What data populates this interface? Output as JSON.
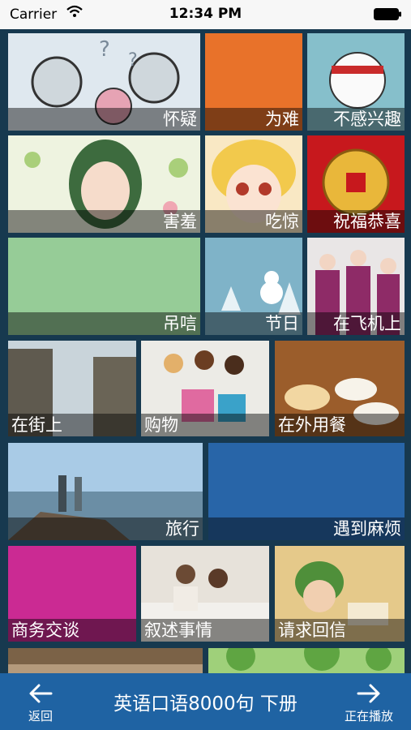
{
  "status_bar": {
    "carrier": "Carrier",
    "time": "12:34 PM"
  },
  "tiles": [
    {
      "label": "怀疑",
      "color": "#d7e3ee"
    },
    {
      "label": "为难",
      "color": "#e8722a"
    },
    {
      "label": "不感兴趣",
      "color": "#7fb7c6"
    },
    {
      "label": "害羞",
      "color": "#e8efd6"
    },
    {
      "label": "吃惊",
      "color": "#f6d9a5"
    },
    {
      "label": "祝福恭喜",
      "color": "#c7181d"
    },
    {
      "label": "吊唁",
      "color": "#96cc97"
    },
    {
      "label": "节日",
      "color": "#7fb3c8"
    },
    {
      "label": "在飞机上",
      "color": "#8c3b6b"
    },
    {
      "label": "在街上",
      "color": "#6f7f86"
    },
    {
      "label": "购物",
      "color": "#e9ded6"
    },
    {
      "label": "在外用餐",
      "color": "#a9662b"
    },
    {
      "label": "旅行",
      "color": "#7fb1d8"
    },
    {
      "label": "遇到麻烦",
      "color": "#2865a8"
    },
    {
      "label": "商务交谈",
      "color": "#cb2a93"
    },
    {
      "label": "叙述事情",
      "color": "#d8cdbf"
    },
    {
      "label": "请求回信",
      "color": "#d3b36c"
    }
  ],
  "bottom_bar": {
    "title": "英语口语8000句 下册",
    "back_label": "返回",
    "now_playing_label": "正在播放"
  }
}
